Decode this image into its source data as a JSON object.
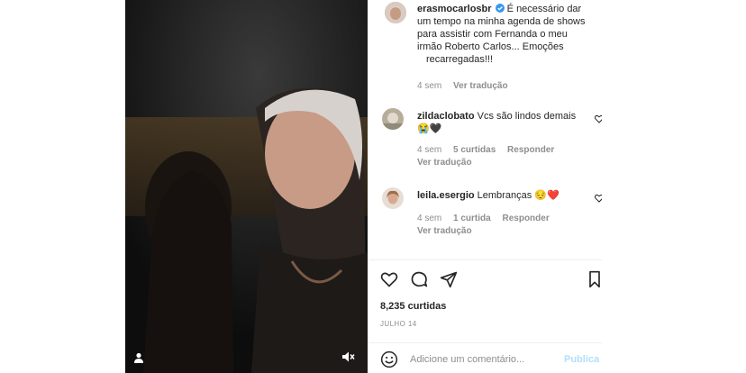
{
  "post": {
    "author": "erasmocarlosbr",
    "caption_lines": [
      "É necessário dar",
      "um tempo na minha agenda de shows",
      "para assistir com Fernanda o meu",
      "irmão Roberto Carlos... Emoções",
      "recarregadas!!!"
    ],
    "time": "4 sem",
    "see_translation": "Ver tradução",
    "likes": "8,235 curtidas",
    "date": "JULHO 14"
  },
  "comments": [
    {
      "username": "zildaclobato",
      "text": "Vcs são lindos demais",
      "emoji": "😭🖤",
      "time": "4 sem",
      "likes": "5 curtidas",
      "reply": "Responder",
      "see_translation": "Ver tradução"
    },
    {
      "username": "leila.esergio",
      "text": "Lembranças",
      "emoji": "😔❤️",
      "time": "4 sem",
      "likes": "1 curtida",
      "reply": "Responder",
      "see_translation": "Ver tradução"
    }
  ],
  "composer": {
    "placeholder": "Adicione um comentário...",
    "post_label": "Publica"
  },
  "colors": {
    "verified": "#3897f0",
    "heart_red": "#ed4956",
    "muted_text": "#8e8e8e",
    "post_disabled": "#b2dffc"
  },
  "icons": [
    "user-tag-icon",
    "muted-speaker-icon",
    "verified-badge-icon",
    "heart-icon",
    "comment-icon",
    "share-icon",
    "bookmark-icon",
    "emoji-icon"
  ]
}
